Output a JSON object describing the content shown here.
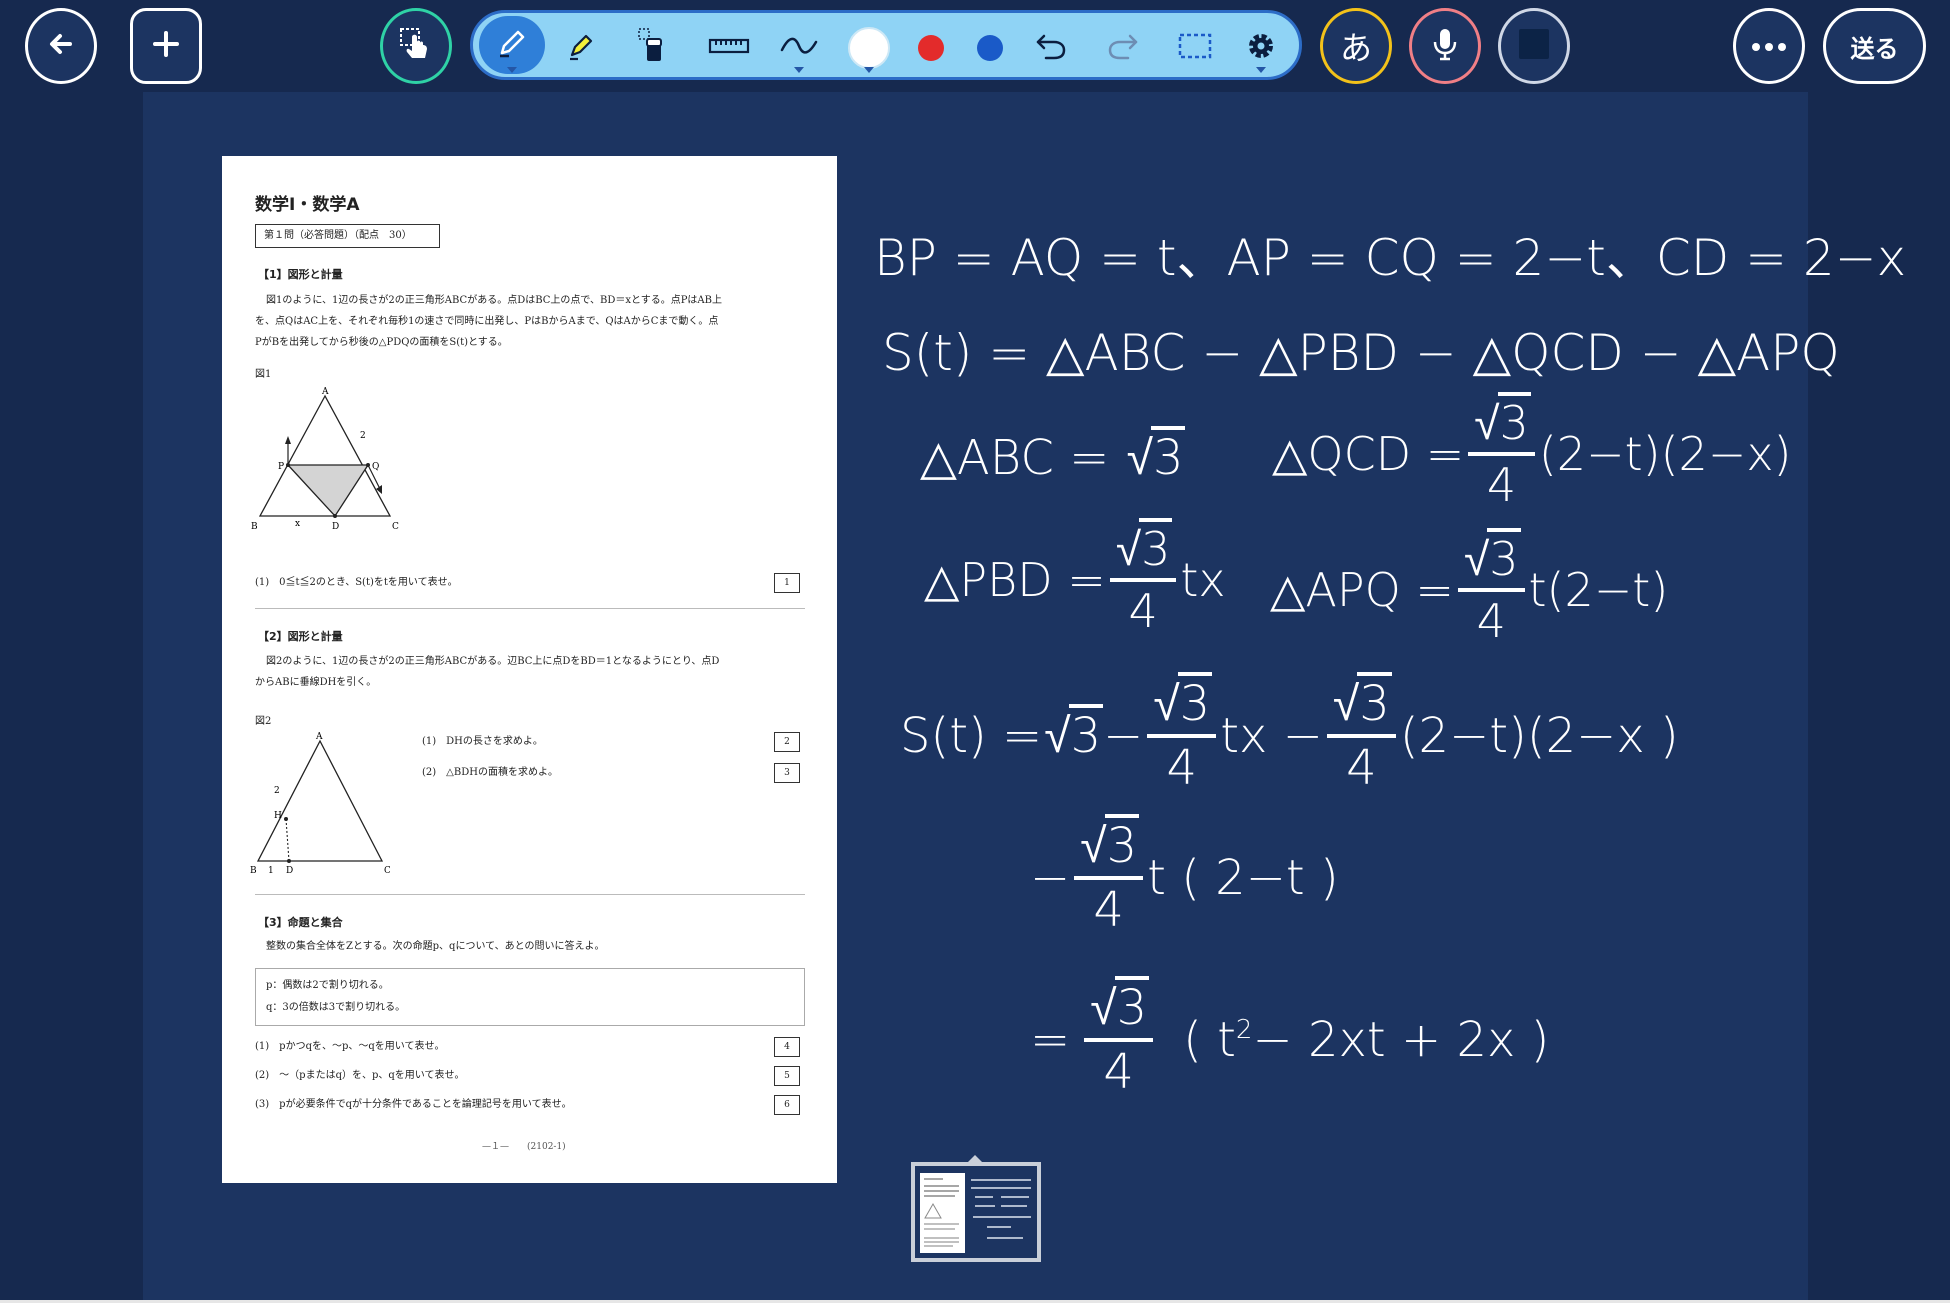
{
  "top_bar": {
    "char_button_label": "あ",
    "send_label": "送る",
    "icons": {
      "back": "arrow-left-icon",
      "add": "plus-icon",
      "touch": "hand-pointer-icon",
      "pen": "pen-icon",
      "highlighter": "highlighter-icon",
      "eraser": "eraser-icon",
      "ruler": "ruler-icon",
      "stroke": "stroke-curve-icon",
      "undo": "undo-icon",
      "redo": "redo-icon",
      "select": "select-rectangle-icon",
      "settings": "gear-icon",
      "mic": "microphone-icon",
      "stop": "stop-icon",
      "more": "more-dots-icon"
    },
    "colors": {
      "white": "#ffffff",
      "red": "#e32b2b",
      "blue": "#1a5ac8"
    }
  },
  "document": {
    "title": "数学Ⅰ・数学A",
    "section_box": "第１問（必答問題）（配点　30）",
    "part1": {
      "heading": "【1】図形と計量",
      "text_lines": [
        "図1のように、1辺の長さが2の正三角形ABCがある。点DはBC上の点で、BD＝xとする。点PはAB上",
        "を、点QはAC上を、それぞれ毎秒1の速さで同時に出発し、PはBからAまで、QはAからCまで動く。点",
        "PがBを出発してから秒後の△PDQの面積をS(t)とする。"
      ],
      "figure_label": "図1",
      "fig_labels": {
        "A": "A",
        "B": "B",
        "C": "C",
        "D": "D",
        "P": "P",
        "Q": "Q",
        "two": "2",
        "x": "x"
      },
      "question1": "(1)　0≦t≦2のとき、S(t)をtを用いて表せ。",
      "q1_box": "1"
    },
    "part2": {
      "heading": "【2】図形と計量",
      "text_lines": [
        "図2のように、1辺の長さが2の正三角形ABCがある。辺BC上に点DをBD＝1となるようにとり、点D",
        "からABに垂線DHを引く。"
      ],
      "figure_label": "図2",
      "fig_labels": {
        "A": "A",
        "B": "B",
        "C": "C",
        "D": "D",
        "H": "H",
        "two": "2",
        "one": "1"
      },
      "q1": "(1)　DHの長さを求めよ。",
      "q1_box": "2",
      "q2": "(2)　△BDHの面積を求めよ。",
      "q2_box": "3"
    },
    "part3": {
      "heading": "【3】命題と集合",
      "intro": "整数の集合全体をZとする。次の命題p、qについて、あとの問いに答えよ。",
      "prop_p": "p：偶数は2で割り切れる。",
      "prop_q": "q：3の倍数は3で割り切れる。",
      "q1": "(1)　pかつqを、〜p、〜qを用いて表せ。",
      "q1_box": "4",
      "q2": "(2)　〜（pまたはq）を、p、qを用いて表せ。",
      "q2_box": "5",
      "q3": "(3)　pが必要条件でqが十分条件であることを論理記号を用いて表せ。",
      "q3_box": "6"
    },
    "footer": "—１—　　(2102-1)"
  },
  "handwriting": {
    "line1": "BP = AQ = t、AP = CQ = 2−t、CD = 2−x",
    "line2": "S(t) = △ABC − △PBD − △QCD − △APQ",
    "abc_lhs": "△ABC = ",
    "abc_root": "3",
    "qcd_lhs": "△QCD =",
    "qcd_root": "3",
    "qcd_den": "4",
    "qcd_tail": "(2−t)(2−x)",
    "pbd_lhs": "△PBD =",
    "pbd_root": "3",
    "pbd_den": "4",
    "pbd_tail": "tx",
    "apq_lhs": "△APQ =",
    "apq_root": "3",
    "apq_den": "4",
    "apq_tail": "t(2−t)",
    "s_lhs": "S(t) = ",
    "s_root1": "3",
    "s_minus1": " − ",
    "s_root2": "3",
    "s_den2": "4",
    "s_mid": "tx − ",
    "s_root3": "3",
    "s_den3": "4",
    "s_tail": "(2−t)(2−x )",
    "l6_minus": "−",
    "l6_root": "3",
    "l6_den": "4",
    "l6_tail": "t ( 2−t )",
    "l7_eq": "=",
    "l7_root": "3",
    "l7_den": "4",
    "l7_tail_a": "( t",
    "l7_sup": "2",
    "l7_tail_b": "− 2xt + 2x )"
  }
}
